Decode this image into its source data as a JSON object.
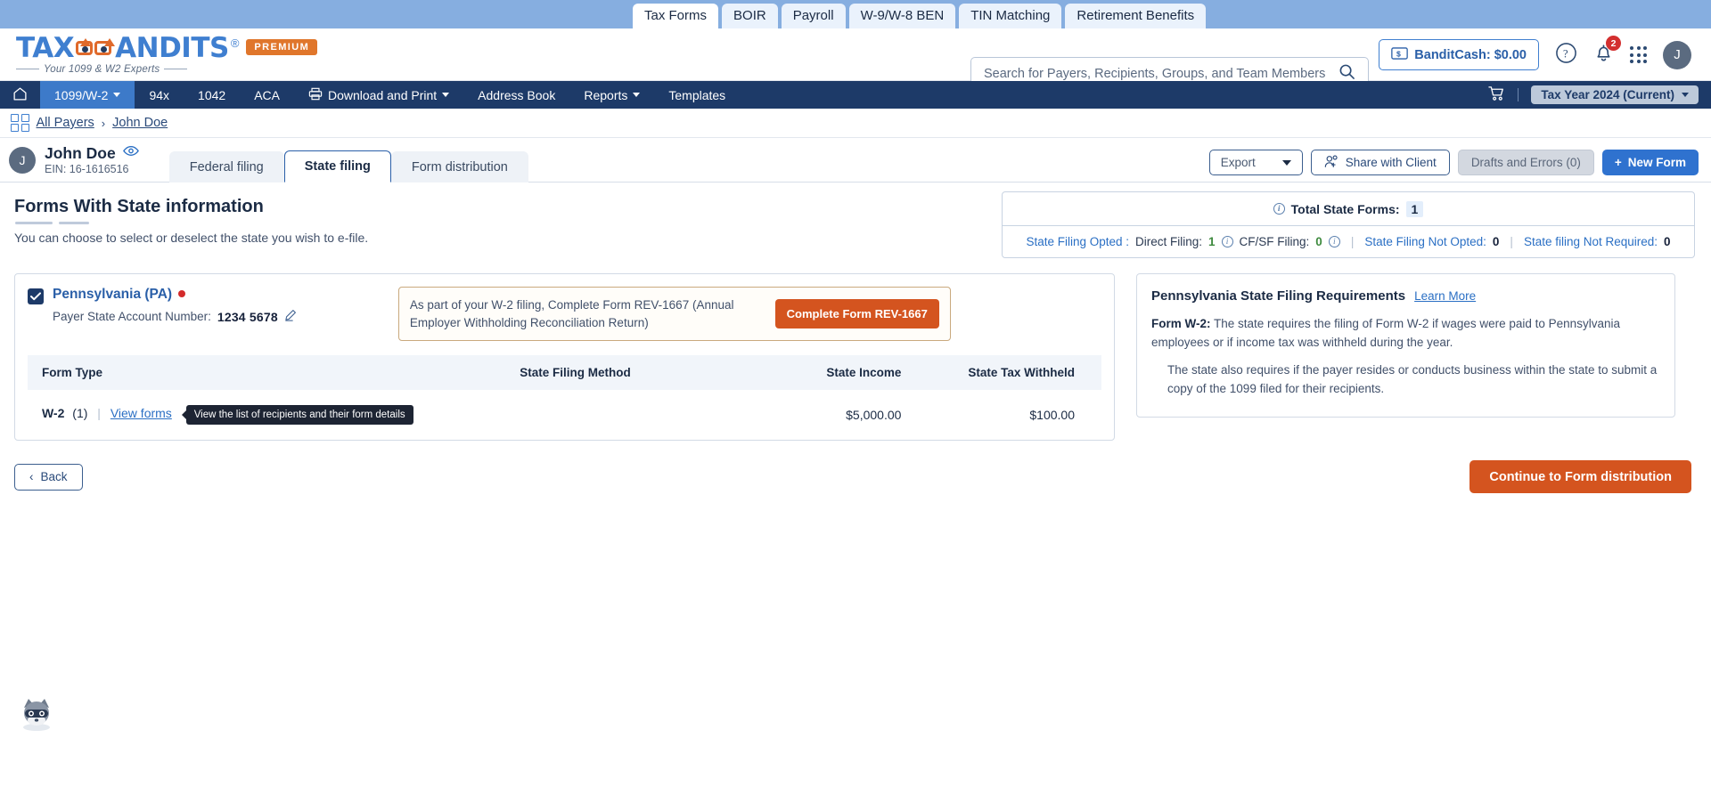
{
  "product_tabs": [
    {
      "label": "Tax Forms",
      "active": true
    },
    {
      "label": "BOIR",
      "active": false
    },
    {
      "label": "Payroll",
      "active": false
    },
    {
      "label": "W-9/W-8 BEN",
      "active": false
    },
    {
      "label": "TIN Matching",
      "active": false
    },
    {
      "label": "Retirement Benefits",
      "active": false
    }
  ],
  "brand": {
    "name_left": "TAX",
    "name_right": "ANDITS",
    "registered": "®",
    "badge": "PREMIUM",
    "tagline": "Your 1099 & W2 Experts"
  },
  "search": {
    "placeholder": "Search for Payers, Recipients, Groups, and Team Members",
    "value": "",
    "icon": "search-icon"
  },
  "header_right": {
    "bandit_cash": "BanditCash: $0.00",
    "bandit_icon": "cash-note-icon",
    "help_icon": "question-circle-icon",
    "bell_icon": "bell-icon",
    "notification_count": "2",
    "apps_icon": "grid-apps-icon",
    "avatar_initial": "J"
  },
  "main_nav": {
    "home_icon": "home-icon",
    "items": [
      {
        "label": "1099/W-2",
        "active": true,
        "caret": true
      },
      {
        "label": "94x",
        "active": false,
        "caret": false
      },
      {
        "label": "1042",
        "active": false,
        "caret": false
      },
      {
        "label": "ACA",
        "active": false,
        "caret": false
      },
      {
        "label": "Download and Print",
        "active": false,
        "caret": true,
        "icon": "printer-icon"
      },
      {
        "label": "Address Book",
        "active": false,
        "caret": false
      },
      {
        "label": "Reports",
        "active": false,
        "caret": true
      },
      {
        "label": "Templates",
        "active": false,
        "caret": false
      }
    ],
    "cart_icon": "shopping-cart-icon",
    "tax_year": "Tax Year 2024 (Current)"
  },
  "breadcrumb": {
    "grid_icon": "grid-squares-icon",
    "items": [
      "All Payers",
      "John Doe"
    ],
    "separator": "›"
  },
  "payer": {
    "avatar_initial": "J",
    "name": "John Doe",
    "eye_icon": "eye-icon",
    "ein": "EIN: 16-1616516",
    "tabs": [
      {
        "label": "Federal filing",
        "active": false
      },
      {
        "label": "State filing",
        "active": true
      },
      {
        "label": "Form distribution",
        "active": false
      }
    ],
    "actions": {
      "export": "Export",
      "share": "Share with Client",
      "share_icon": "user-add-icon",
      "drafts": "Drafts and Errors (0)",
      "new_form": "New  Form",
      "new_form_icon": "plus-icon"
    }
  },
  "section": {
    "title": "Forms With State information",
    "subtitle": "You can choose to select or deselect the state you wish to e-file."
  },
  "summary": {
    "info_icon": "info-icon",
    "total_label": "Total State Forms:",
    "total_value": "1",
    "opted_label": "State Filing Opted :",
    "direct_label": "Direct Filing:",
    "direct_value": "1",
    "cfsf_label": "CF/SF Filing:",
    "cfsf_value": "0",
    "not_opted_label": "State Filing Not Opted:",
    "not_opted_value": "0",
    "not_required_label": "State filing Not Required:",
    "not_required_value": "0"
  },
  "state_card": {
    "checkbox_checked": true,
    "check_icon": "check-icon",
    "state_name": "Pennsylvania (PA)",
    "status_dot": "red-status-dot",
    "account_label": "Payer State Account Number:",
    "account_value": "1234 5678",
    "edit_icon": "pencil-edit-icon",
    "notice_text": "As part of your W-2 filing, Complete Form REV-1667 (Annual Employer Withholding Reconciliation Return)",
    "notice_button": "Complete Form REV-1667",
    "table": {
      "columns": [
        "Form Type",
        "State Filing Method",
        "State Income",
        "State Tax Withheld"
      ],
      "rows": [
        {
          "form_type": "W-2",
          "form_count": "(1)",
          "divider": "|",
          "view_forms": "View forms",
          "tooltip": "View the list of recipients and their form details",
          "state_filing_method": "",
          "state_income": "$5,000.00",
          "state_tax_withheld": "$100.00"
        }
      ]
    }
  },
  "requirements": {
    "title": "Pennsylvania State Filing Requirements",
    "learn_more": "Learn More",
    "form_label": "Form W-2:",
    "paragraph1": "The state requires the filing of Form W-2 if wages were paid to Pennsylvania employees or if income tax was withheld during the year.",
    "paragraph2": "The state also requires if the payer resides or conducts business within the state to submit a copy of the 1099 filed for their recipients."
  },
  "footer": {
    "back_label": "Back",
    "back_icon": "chevron-left-icon",
    "continue_label": "Continue to Form distribution"
  },
  "mascot": {
    "icon": "bandit-raccoon-mascot"
  },
  "colors": {
    "top_strip": "#86aee0",
    "nav_dark": "#1d3a68",
    "nav_active": "#3d7ac9",
    "accent_blue": "#2f72cf",
    "accent_orange": "#d4541f",
    "link_blue": "#2a6fc4",
    "status_red": "#d42b2b"
  }
}
